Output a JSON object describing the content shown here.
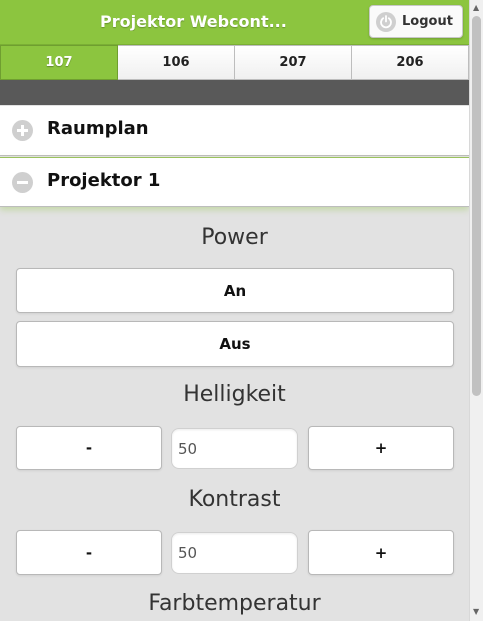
{
  "header": {
    "title": "Projektor Webcont...",
    "logout_label": "Logout",
    "accent": "#8cc53f"
  },
  "tabs": [
    {
      "label": "107",
      "active": true
    },
    {
      "label": "106"
    },
    {
      "label": "207"
    },
    {
      "label": "206"
    }
  ],
  "panels": {
    "raumplan": {
      "label": "Raumplan",
      "state": "collapsed"
    },
    "projektor": {
      "label": "Projektor 1",
      "state": "expanded"
    }
  },
  "power": {
    "title": "Power",
    "on_label": "An",
    "off_label": "Aus"
  },
  "helligkeit": {
    "title": "Helligkeit",
    "minus": "-",
    "value": "50",
    "plus": "+"
  },
  "kontrast": {
    "title": "Kontrast",
    "minus": "-",
    "value": "50",
    "plus": "+"
  },
  "farbtemperatur": {
    "title": "Farbtemperatur"
  }
}
